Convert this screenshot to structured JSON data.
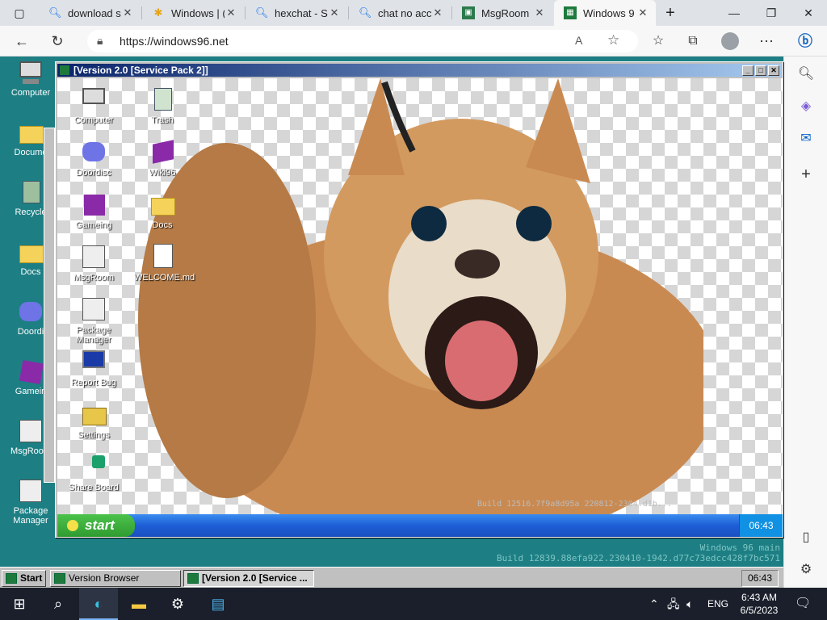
{
  "browser": {
    "tabs": [
      {
        "title": "download s",
        "icon": "search-icon"
      },
      {
        "title": "Windows | (",
        "icon": "pinwheel-icon"
      },
      {
        "title": "hexchat - S",
        "icon": "search-icon"
      },
      {
        "title": "chat no acc",
        "icon": "search-icon"
      },
      {
        "title": "MsgRoom",
        "icon": "msgroom-icon"
      },
      {
        "title": "Windows 9",
        "icon": "windows96-icon"
      }
    ],
    "url": "https://windows96.net",
    "new_tab": "+"
  },
  "desktop": {
    "icons": [
      {
        "label": "Computer"
      },
      {
        "label": "Docume"
      },
      {
        "label": "Recycle"
      },
      {
        "label": "Docs"
      },
      {
        "label": "Doordi"
      },
      {
        "label": "Gamein"
      },
      {
        "label": "MsgRoom"
      },
      {
        "label": "Package Manager"
      }
    ]
  },
  "window": {
    "title": "[Version 2.0 [Service Pack 2]]",
    "icons_col1": [
      {
        "label": "Computer"
      },
      {
        "label": "Doordisc"
      },
      {
        "label": "Gameing"
      },
      {
        "label": "MsgRoom"
      },
      {
        "label": "Package Manager"
      },
      {
        "label": "Report Bug"
      },
      {
        "label": "Settings"
      },
      {
        "label": "Share Board"
      }
    ],
    "icons_col2": [
      {
        "label": "Trash"
      },
      {
        "label": "Wiki96"
      },
      {
        "label": "Docs"
      },
      {
        "label": "WELCOME.md"
      }
    ],
    "start": "start",
    "clock": "06:43",
    "build_inner": "Build 12516.7f9a8d95a 220812-2304.d1b..."
  },
  "w96": {
    "build_line1": "Windows 96 main",
    "build_line2": "Build 12839.88efa922.230410-1942.d77c73edcc428f7bc571",
    "taskbar": {
      "start": "Start",
      "items": [
        {
          "label": "Version Browser"
        },
        {
          "label": "[Version 2.0 [Service ..."
        }
      ],
      "clock": "06:43"
    }
  },
  "os_taskbar": {
    "lang": "ENG",
    "time": "6:43 AM",
    "date": "6/5/2023"
  }
}
